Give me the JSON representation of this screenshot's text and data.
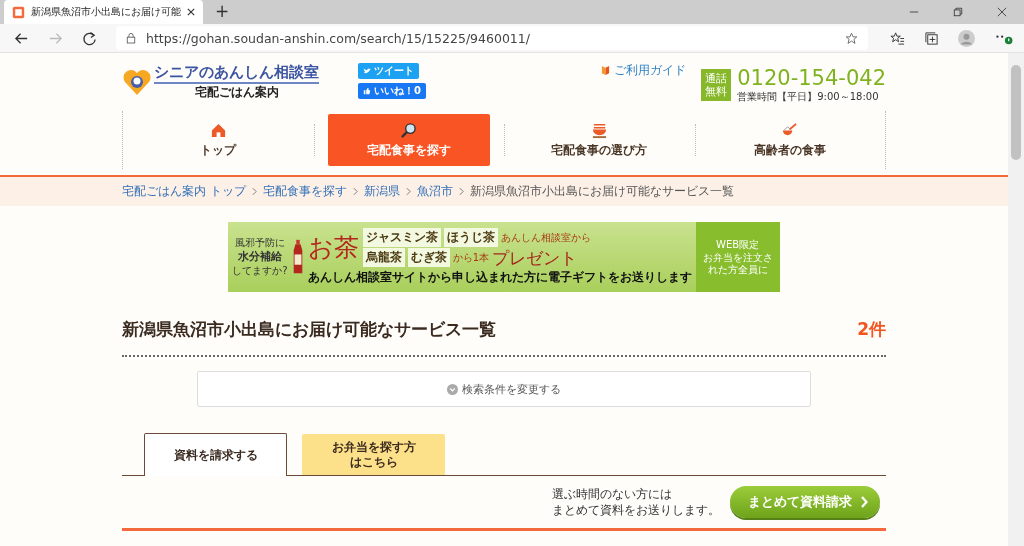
{
  "browser": {
    "tab_title": "新潟県魚沼市小出島にお届け可能",
    "url": "https://gohan.soudan-anshin.com/search/15/15225/9460011/",
    "new_tab": "+"
  },
  "header": {
    "logo_title": "シニアのあんしん相談室",
    "logo_sub": "宅配ごはん案内",
    "tweet": "ツイート",
    "like": "いいね！0",
    "guide": "ご利用ガイド",
    "free_call": "通話無料",
    "phone": "0120-154-042",
    "hours": "営業時間【平日】9:00～18:00"
  },
  "nav": [
    {
      "label": "トップ",
      "selected": false
    },
    {
      "label": "宅配食事を探す",
      "selected": true
    },
    {
      "label": "宅配食事の選び方",
      "selected": false
    },
    {
      "label": "高齢者の食事",
      "selected": false
    }
  ],
  "breadcrumb": [
    {
      "label": "宅配ごはん案内 トップ",
      "current": false
    },
    {
      "label": "宅配食事を探す",
      "current": false
    },
    {
      "label": "新潟県",
      "current": false
    },
    {
      "label": "魚沼市",
      "current": false
    },
    {
      "label": "新潟県魚沼市小出島にお届け可能なサービス一覧",
      "current": true
    }
  ],
  "banner": {
    "lead": [
      "風邪予防に",
      "水分補給",
      "してますか?"
    ],
    "headline": "お茶",
    "teas": [
      "ジャスミン茶",
      "ほうじ茶",
      "烏龍茶",
      "むぎ茶"
    ],
    "count": "から1本",
    "from": "あんしん相談室から",
    "present": "プレゼント",
    "note": "あんしん相談室サイトから申し込まれた方に電子ギフトをお送りします",
    "web_only": "WEB限定",
    "condition": "お弁当を注文された方全員に"
  },
  "page_title": "新潟県魚沼市小出島にお届け可能なサービス一覧",
  "result_count": "2件",
  "change_search": "検索条件を変更する",
  "tabs": [
    {
      "label": "資料を請求する",
      "selected": true
    },
    {
      "label": "お弁当を探す方はこちら",
      "selected": false
    }
  ],
  "request_note": [
    "選ぶ時間のない方には",
    "まとめて資料をお送りします。"
  ],
  "request_button": "まとめて資料請求"
}
